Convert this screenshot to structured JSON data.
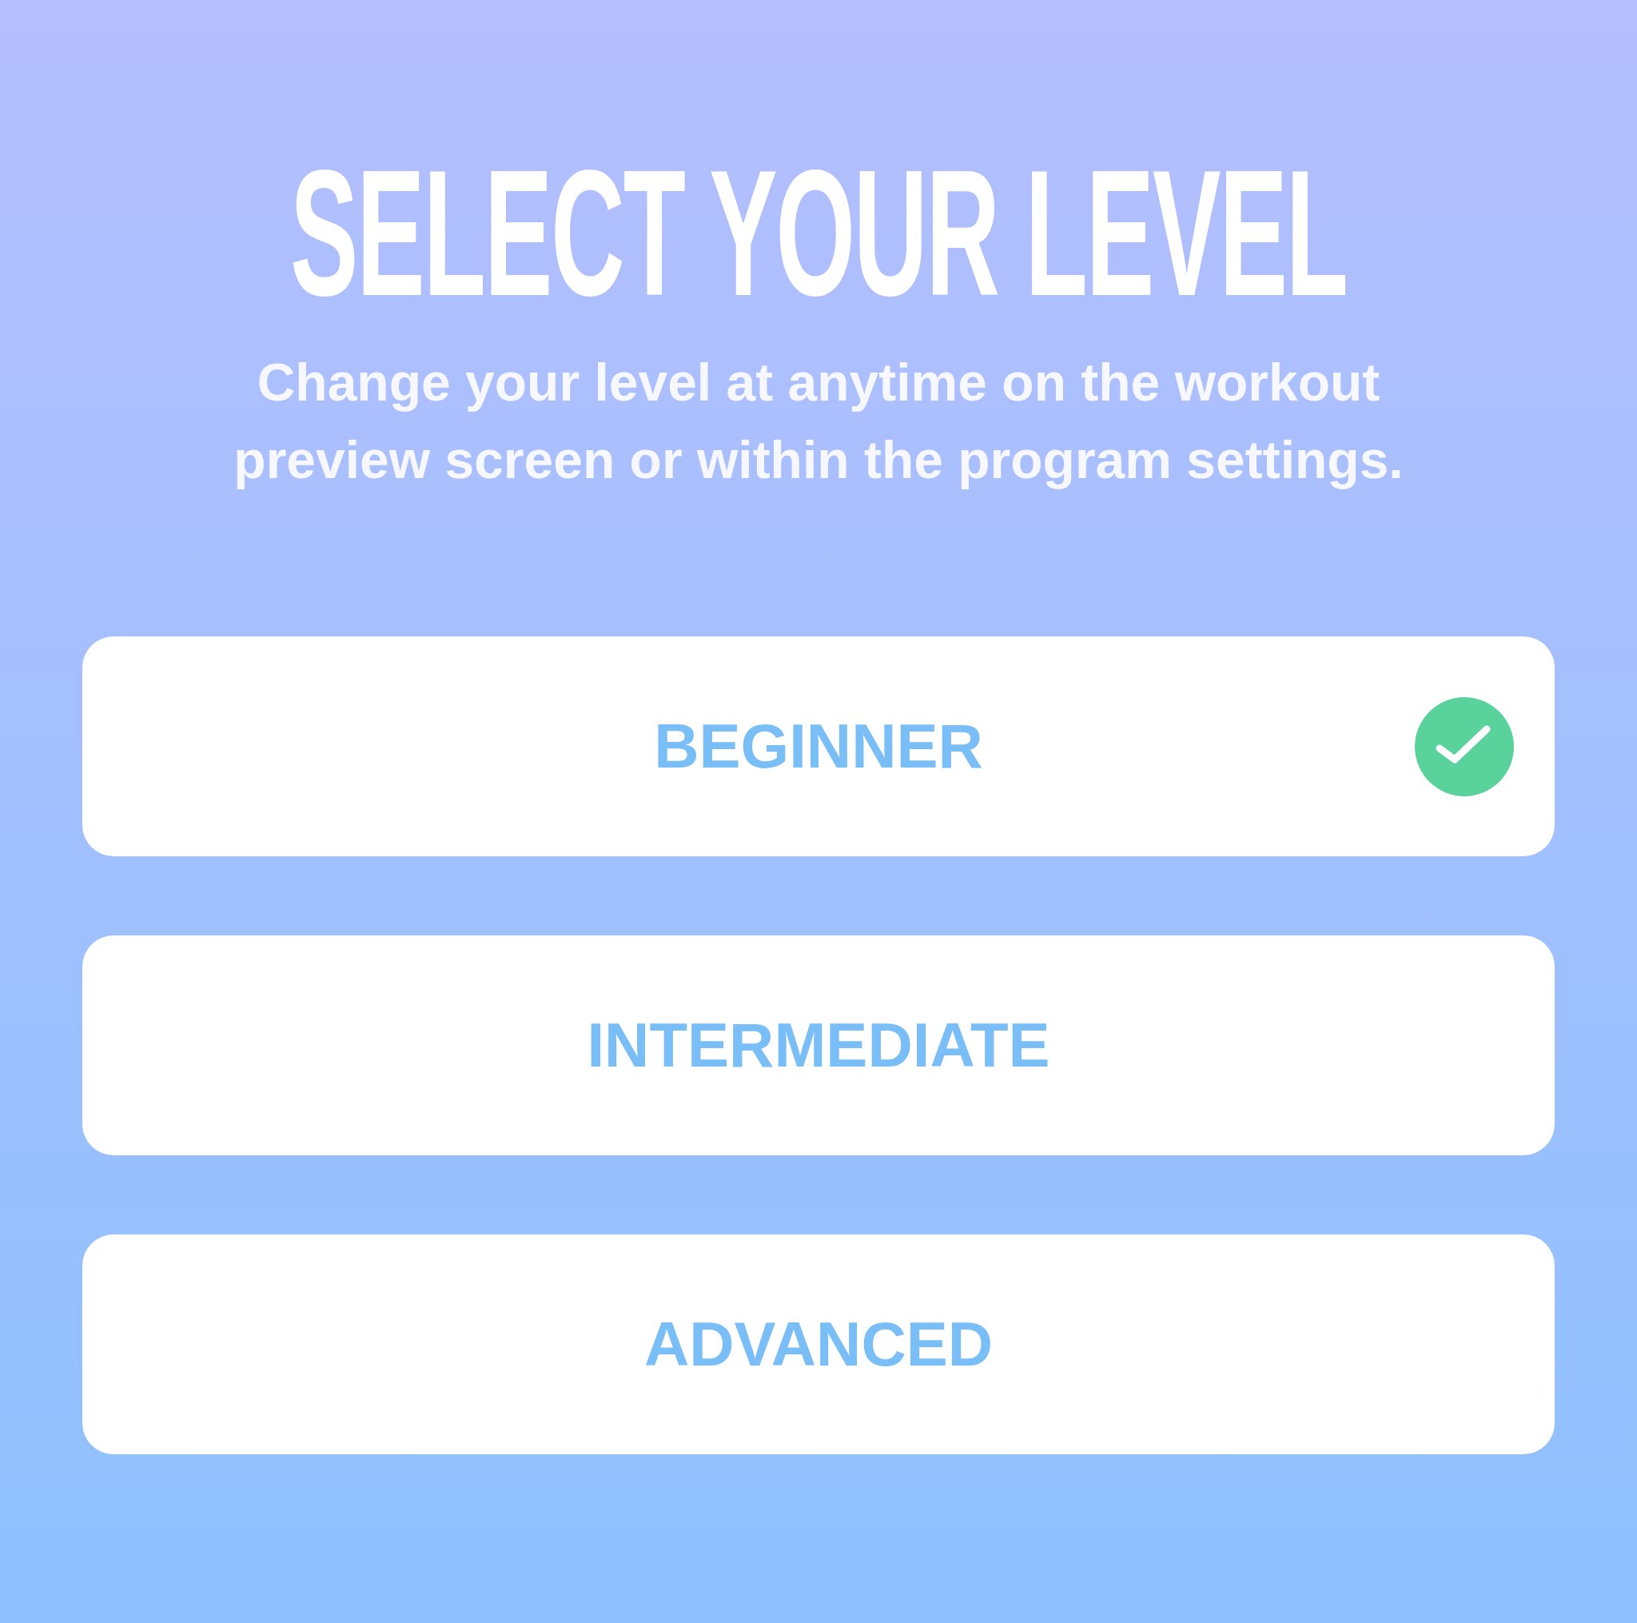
{
  "title": "SELECT YOUR LEVEL",
  "subtitle": "Change your level at anytime on the workout preview screen or within the program settings.",
  "levels": [
    {
      "label": "BEGINNER",
      "selected": true
    },
    {
      "label": "INTERMEDIATE",
      "selected": false
    },
    {
      "label": "ADVANCED",
      "selected": false
    }
  ]
}
